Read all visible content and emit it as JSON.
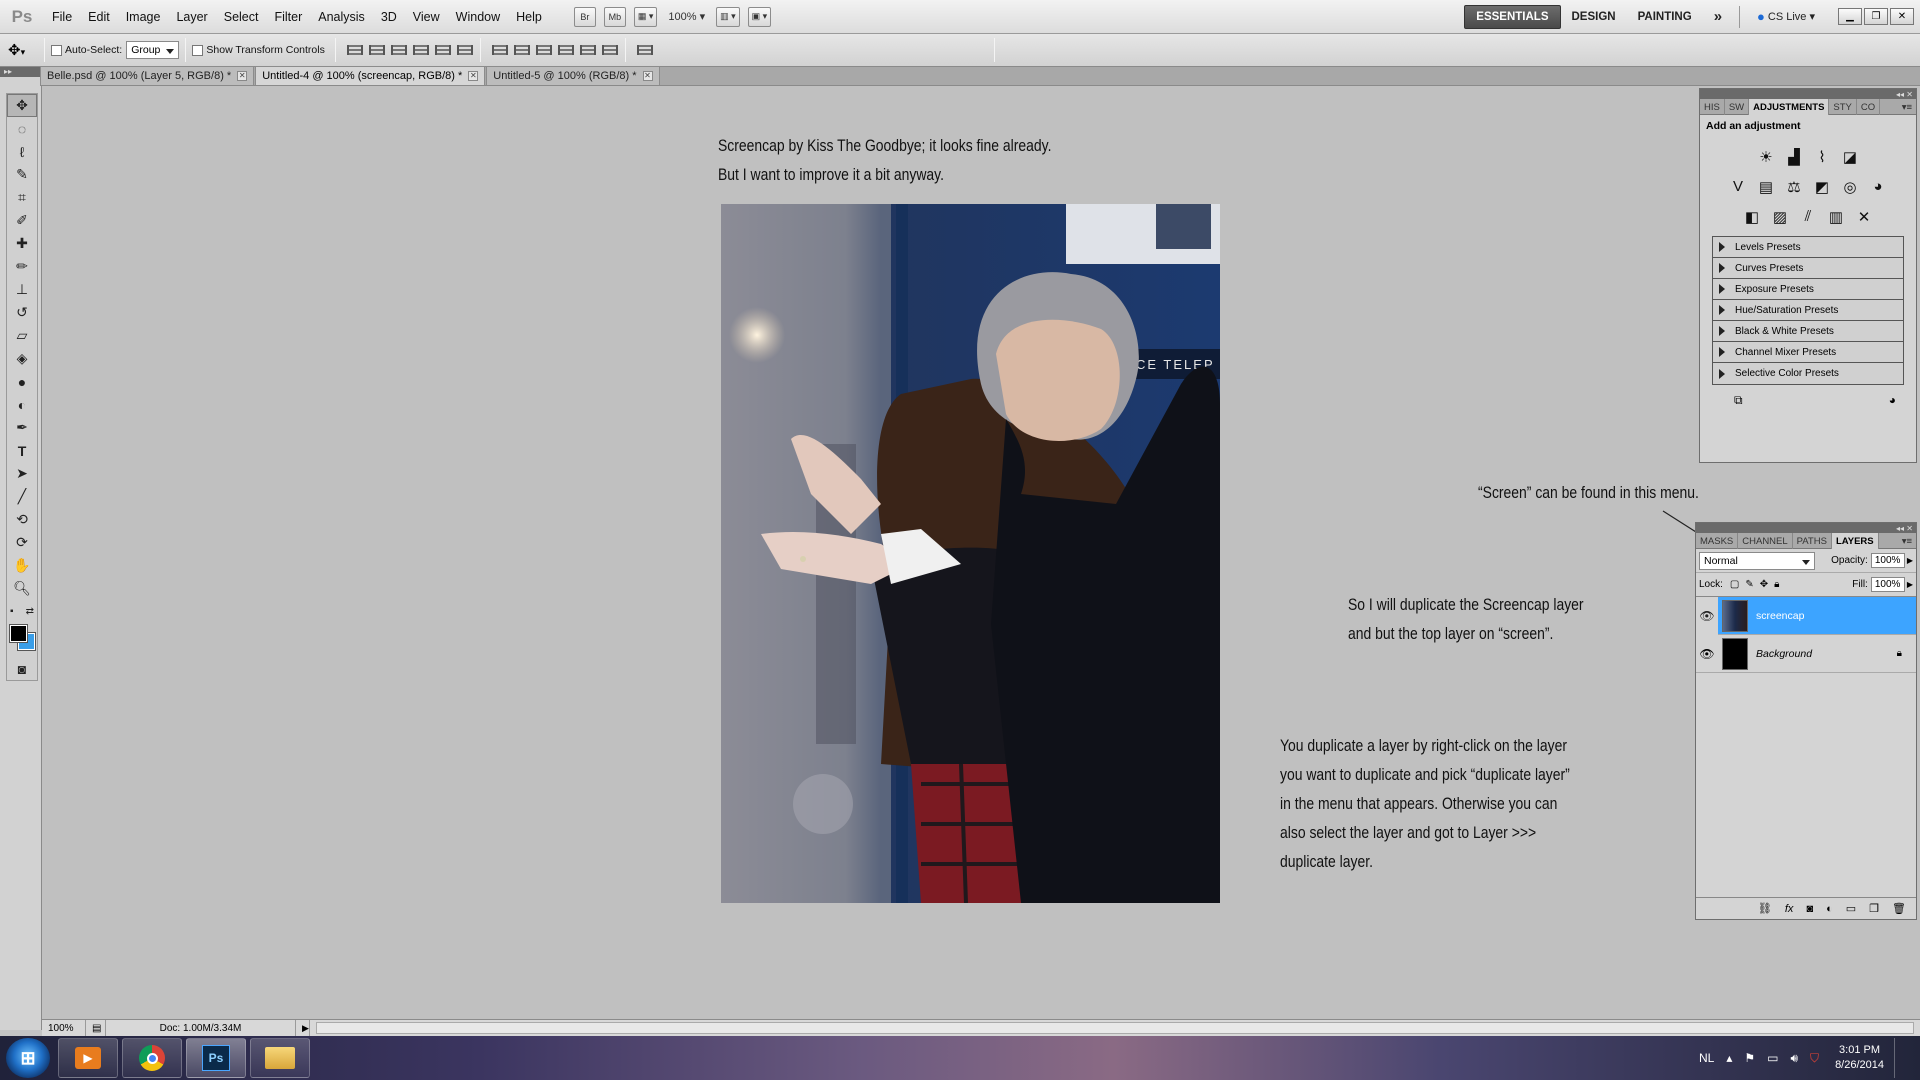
{
  "menubar": {
    "logo": "Ps",
    "items": [
      "File",
      "Edit",
      "Image",
      "Layer",
      "Select",
      "Filter",
      "Analysis",
      "3D",
      "View",
      "Window",
      "Help"
    ],
    "tool_buttons": [
      "Br",
      "Mb"
    ],
    "zoom": "100%",
    "workspaces": [
      "ESSENTIALS",
      "DESIGN",
      "PAINTING"
    ],
    "more": "»",
    "cslive": "CS Live"
  },
  "options": {
    "auto_select_label": "Auto-Select:",
    "auto_select_value": "Group",
    "transform_label": "Show Transform Controls"
  },
  "tabs": [
    {
      "label": "Belle.psd @ 100% (Layer 5, RGB/8) *",
      "active": false
    },
    {
      "label": "Untitled-4 @ 100% (screencap, RGB/8) *",
      "active": true
    },
    {
      "label": "Untitled-5 @ 100% (RGB/8) *",
      "active": false
    }
  ],
  "canvas_notes": {
    "intro_line1": "Screencap by Kiss The Goodbye; it looks fine already.",
    "intro_line2": "But I want to improve it a bit anyway.",
    "screen_note": "“Screen” can be found in this menu.",
    "dup_line1": "So I will duplicate the Screencap layer",
    "dup_line2": "and but the top layer on “screen”.",
    "how_line1": "You duplicate a layer by right-click on the layer",
    "how_line2": "you want to duplicate and pick “duplicate layer”",
    "how_line3": "in the menu that appears. Otherwise you can",
    "how_line4": "also select the layer and got to Layer >>>",
    "how_line5": "duplicate layer."
  },
  "photo_text": "CE TELEP",
  "status": {
    "zoom": "100%",
    "doc": "Doc: 1.00M/3.34M"
  },
  "adjustments": {
    "tabs": [
      "HIS",
      "SW",
      "ADJUSTMENTS",
      "STY",
      "CO"
    ],
    "title": "Add an adjustment",
    "presets": [
      "Levels Presets",
      "Curves Presets",
      "Exposure Presets",
      "Hue/Saturation Presets",
      "Black & White Presets",
      "Channel Mixer Presets",
      "Selective Color Presets"
    ]
  },
  "layers": {
    "tabs": [
      "MASKS",
      "CHANNEL",
      "PATHS",
      "LAYERS"
    ],
    "blend_mode": "Normal",
    "opacity_label": "Opacity:",
    "opacity": "100%",
    "lock_label": "Lock:",
    "fill_label": "Fill:",
    "fill": "100%",
    "rows": [
      {
        "name": "screencap",
        "selected": true
      },
      {
        "name": "Background",
        "selected": false
      }
    ]
  },
  "taskbar": {
    "lang": "NL",
    "time": "3:01 PM",
    "date": "8/26/2014"
  }
}
